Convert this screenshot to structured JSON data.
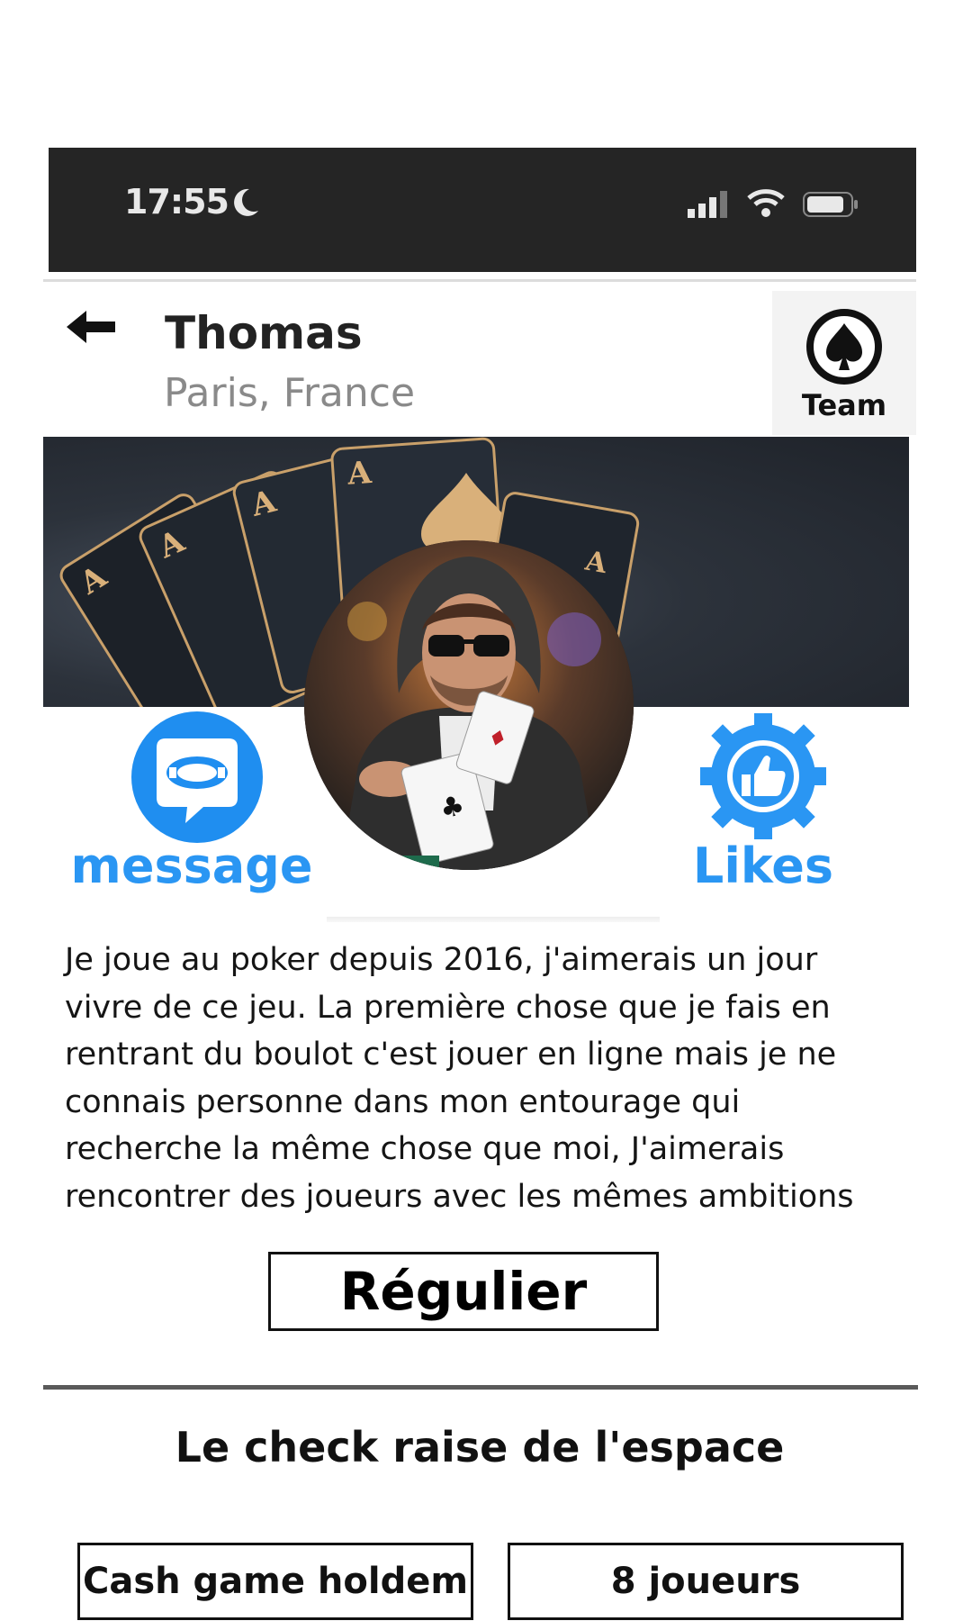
{
  "status_bar": {
    "time": "17:55"
  },
  "header": {
    "back_icon": "arrow-left-icon",
    "name": "Thomas",
    "location": "Paris, France",
    "team_icon": "spade-icon",
    "team_label": "Team"
  },
  "actions": {
    "message_label": "message",
    "likes_label": "Likes",
    "accent_color": "#2a96f3"
  },
  "bio": {
    "lines": [
      "Je joue au poker depuis 2016, j'aimerais un jour",
      "vivre de ce jeu. La première chose que je fais en",
      "rentrant du boulot c'est jouer en ligne mais je ne",
      "connais personne dans mon entourage qui",
      "recherche la même chose que moi, J'aimerais",
      "rencontrer des joueurs avec les mêmes ambitions"
    ]
  },
  "level": "Régulier",
  "tagline": "Le check raise de l'espace",
  "tags": [
    "Cash game holdem",
    "8 joueurs"
  ]
}
